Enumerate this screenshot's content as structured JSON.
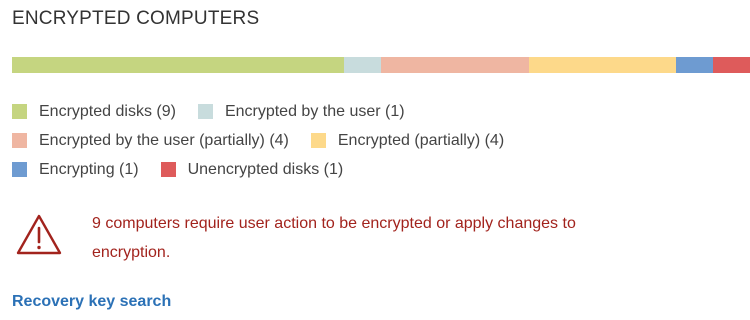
{
  "widget": {
    "title": "ENCRYPTED COMPUTERS"
  },
  "chart_data": {
    "type": "bar",
    "orientation": "horizontal-stacked",
    "categories": [
      "Encrypted disks",
      "Encrypted by the user",
      "Encrypted by the user (partially)",
      "Encrypted (partially)",
      "Encrypting",
      "Unencrypted disks"
    ],
    "values": [
      9,
      1,
      4,
      4,
      1,
      1
    ],
    "colors": [
      "#c5d580",
      "#c8dcdd",
      "#efb6a2",
      "#fdd98a",
      "#6e9bd1",
      "#de5b5b"
    ]
  },
  "legend": {
    "rows": [
      [
        {
          "label": "Encrypted disks (9)",
          "color": "#c5d580"
        },
        {
          "label": "Encrypted by the user (1)",
          "color": "#c8dcdd"
        }
      ],
      [
        {
          "label": "Encrypted by the user (partially) (4)",
          "color": "#efb6a2"
        },
        {
          "label": "Encrypted (partially) (4)",
          "color": "#fdd98a"
        }
      ],
      [
        {
          "label": "Encrypting (1)",
          "color": "#6e9bd1"
        },
        {
          "label": "Unencrypted disks (1)",
          "color": "#de5b5b"
        }
      ]
    ]
  },
  "warning": {
    "icon": "warning-triangle-icon",
    "color": "#a2231d",
    "line1": "9 computers require user action to be encrypted or apply changes to",
    "line2": "encryption."
  },
  "footer": {
    "link_label": "Recovery key search",
    "link_color": "#2b71b6"
  }
}
